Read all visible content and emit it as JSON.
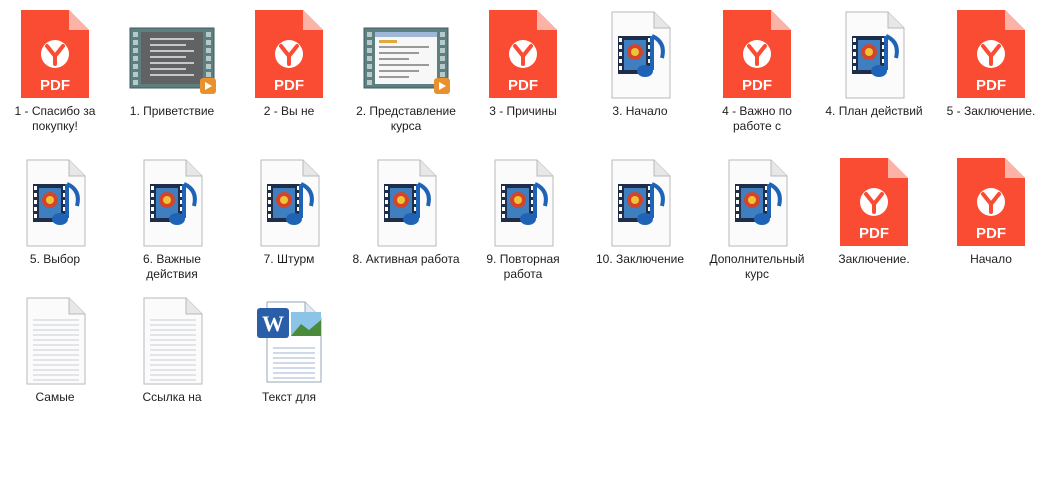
{
  "files": [
    {
      "name": "1 - Спасибо за покупку!",
      "type": "pdf"
    },
    {
      "name": "1. Приветствие",
      "type": "video"
    },
    {
      "name": "2 - Вы не",
      "type": "pdf"
    },
    {
      "name": "2. Представление курса",
      "type": "video"
    },
    {
      "name": "3 - Причины",
      "type": "pdf"
    },
    {
      "name": "3. Начало",
      "type": "audio"
    },
    {
      "name": "4 - Важно по работе с",
      "type": "pdf"
    },
    {
      "name": "4. План действий",
      "type": "audio"
    },
    {
      "name": "5 - Заключение.",
      "type": "pdf"
    },
    {
      "name": "5. Выбор",
      "type": "audio"
    },
    {
      "name": "6. Важные действия",
      "type": "audio"
    },
    {
      "name": "7. Штурм",
      "type": "audio"
    },
    {
      "name": "8. Активная работа",
      "type": "audio"
    },
    {
      "name": "9. Повторная работа",
      "type": "audio"
    },
    {
      "name": "10. Заключение",
      "type": "audio"
    },
    {
      "name": "Дополнительный курс",
      "type": "audio"
    },
    {
      "name": "Заключение.",
      "type": "pdf"
    },
    {
      "name": "Начало",
      "type": "pdf"
    },
    {
      "name": "Самые",
      "type": "text"
    },
    {
      "name": "Ссылка на",
      "type": "text"
    },
    {
      "name": "Текст для",
      "type": "word"
    }
  ],
  "pdf_badge": "PDF",
  "word_badge": "W",
  "colors": {
    "pdf": "#fa4b33",
    "pdf_fold": "#fcb3a7",
    "film": "#5e7f80",
    "word": "#2a5ea8"
  }
}
